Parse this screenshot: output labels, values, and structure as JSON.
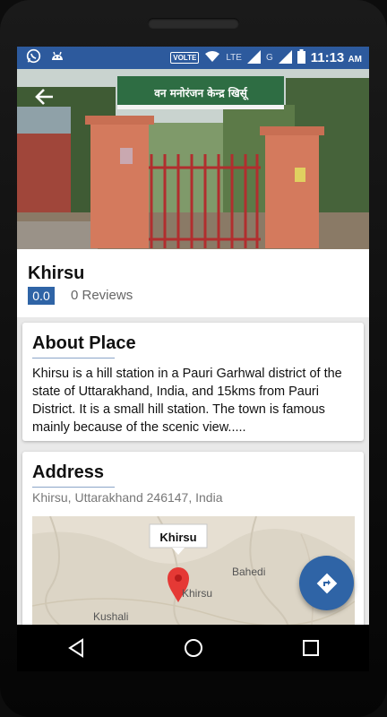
{
  "status_bar": {
    "volte_label": "VOLTE",
    "network_label": "LTE",
    "network_label_2": "G",
    "time": "11:13",
    "ampm": "AM",
    "icons": [
      "whatsapp-icon",
      "android-icon",
      "wifi-icon",
      "signal-icon",
      "signal-icon-2",
      "battery-icon"
    ]
  },
  "place": {
    "name": "Khirsu",
    "rating": "0.0",
    "reviews": "0 Reviews"
  },
  "about": {
    "title": "About Place",
    "text": "Khirsu is a hill station in a Pauri Garhwal district of the state of Uttarakhand, India, and 15kms from Pauri District.  It is a small hill station. The town is famous mainly because of the scenic view....."
  },
  "address": {
    "title": "Address",
    "text": "Khirsu, Uttarakhand 246147, India"
  },
  "map": {
    "marker_label": "Khirsu",
    "labels": [
      "Khirsu",
      "Bahedi",
      "Kushali"
    ]
  },
  "colors": {
    "primary": "#2f64a6",
    "status_bar": "#2d5a9d",
    "marker": "#e53935"
  },
  "hero": {
    "sign_text": "वन मनोरंजन केन्द्र खिर्सू"
  }
}
